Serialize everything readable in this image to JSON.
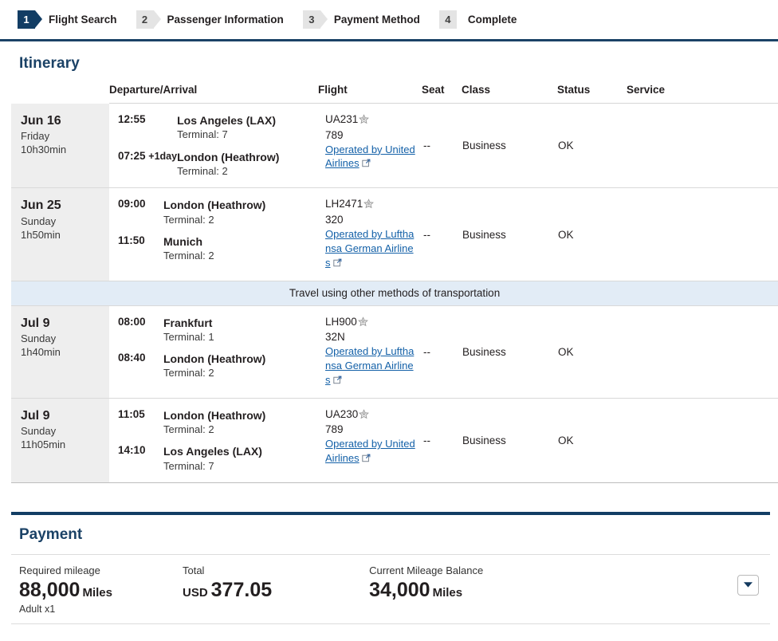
{
  "steps": [
    {
      "num": "1",
      "label": "Flight Search",
      "active": true,
      "shape": "arrow"
    },
    {
      "num": "2",
      "label": "Passenger Information",
      "active": false,
      "shape": "arrow"
    },
    {
      "num": "3",
      "label": "Payment Method",
      "active": false,
      "shape": "arrow"
    },
    {
      "num": "4",
      "label": "Complete",
      "active": false,
      "shape": "plain"
    }
  ],
  "itinerary": {
    "title": "Itinerary",
    "columns": {
      "date": "",
      "departure_arrival": "Departure/Arrival",
      "flight": "Flight",
      "seat": "Seat",
      "class": "Class",
      "status": "Status",
      "service": "Service"
    },
    "other_transport_note": "Travel using other methods of transportation",
    "star_icon": "star-icon",
    "external_link_icon": "external-link-icon",
    "segments": [
      {
        "date": "Jun 16",
        "weekday": "Friday",
        "duration": "10h30min",
        "dep_time": "12:55",
        "dep_place": "Los Angeles (LAX)",
        "dep_terminal": "Terminal: 7",
        "arr_time": "07:25",
        "arr_day_offset": "+1day",
        "arr_place": "London (Heathrow)",
        "arr_terminal": "Terminal: 2",
        "flight_no": "UA231",
        "equipment": "789",
        "operated_by": "Operated by United Airlines",
        "seat": "--",
        "cabin_class": "Business",
        "status": "OK",
        "service": ""
      },
      {
        "date": "Jun 25",
        "weekday": "Sunday",
        "duration": "1h50min",
        "dep_time": "09:00",
        "dep_place": "London (Heathrow)",
        "dep_terminal": "Terminal: 2",
        "arr_time": "11:50",
        "arr_day_offset": "",
        "arr_place": "Munich",
        "arr_terminal": "Terminal: 2",
        "flight_no": "LH2471",
        "equipment": "320",
        "operated_by": "Operated by Lufthansa German Airlines",
        "seat": "--",
        "cabin_class": "Business",
        "status": "OK",
        "service": ""
      },
      {
        "date": "Jul 9",
        "weekday": "Sunday",
        "duration": "1h40min",
        "dep_time": "08:00",
        "dep_place": "Frankfurt",
        "dep_terminal": "Terminal: 1",
        "arr_time": "08:40",
        "arr_day_offset": "",
        "arr_place": "London (Heathrow)",
        "arr_terminal": "Terminal: 2",
        "flight_no": "LH900",
        "equipment": "32N",
        "operated_by": "Operated by Lufthansa German Airlines",
        "seat": "--",
        "cabin_class": "Business",
        "status": "OK",
        "service": ""
      },
      {
        "date": "Jul 9",
        "weekday": "Sunday",
        "duration": "11h05min",
        "dep_time": "11:05",
        "dep_place": "London (Heathrow)",
        "dep_terminal": "Terminal: 2",
        "arr_time": "14:10",
        "arr_day_offset": "",
        "arr_place": "Los Angeles (LAX)",
        "arr_terminal": "Terminal: 7",
        "flight_no": "UA230",
        "equipment": "789",
        "operated_by": "Operated by United Airlines",
        "seat": "--",
        "cabin_class": "Business",
        "status": "OK",
        "service": ""
      }
    ]
  },
  "payment": {
    "title": "Payment",
    "required_mileage_label": "Required mileage",
    "required_mileage_value": "88,000",
    "required_mileage_unit": "Miles",
    "passenger_count": "Adult x1",
    "total_label": "Total",
    "total_currency": "USD",
    "total_value": "377.05",
    "balance_label": "Current Mileage Balance",
    "balance_value": "34,000",
    "balance_unit": "Miles",
    "expand_icon": "chevron-down-icon"
  },
  "colors": {
    "brand_navy": "#123d64",
    "heading_navy": "#1b4266",
    "link_blue": "#1461a8",
    "row_date_bg": "#eeeeee",
    "note_bg": "#e2ecf6"
  }
}
